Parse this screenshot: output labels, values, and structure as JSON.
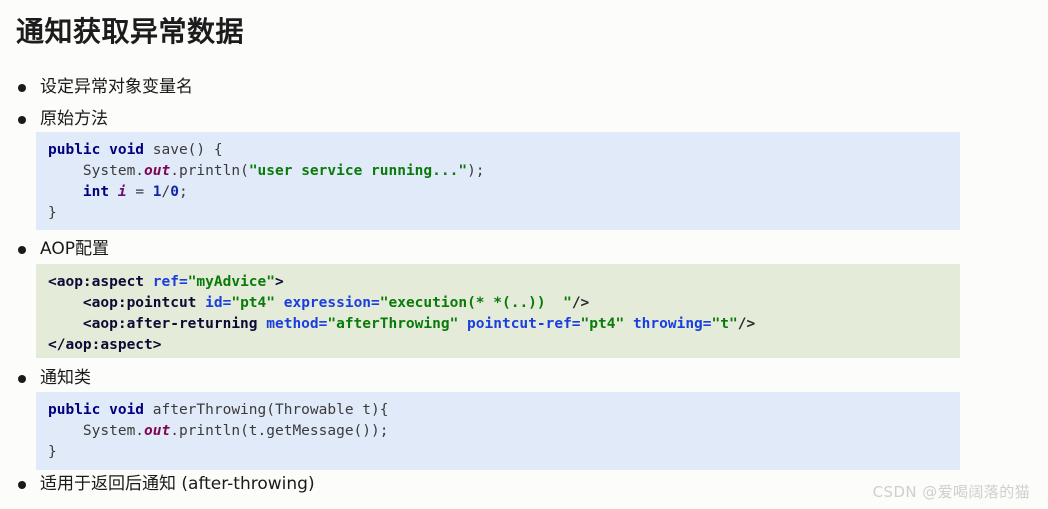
{
  "slide": {
    "title": "通知获取异常数据",
    "watermark": "CSDN @爱喝阔落的猫"
  },
  "bullets": [
    {
      "label": "设定异常对象变量名"
    },
    {
      "label": "原始方法"
    },
    {
      "label": "AOP配置"
    },
    {
      "label": "通知类"
    },
    {
      "label": "适用于返回后通知 (after-throwing)"
    }
  ],
  "code_blocks": [
    {
      "id": "java-save-method",
      "language": "java",
      "background": "#e1eaf8",
      "lines": [
        {
          "tokens": [
            {
              "t": "public void",
              "c": "kw"
            },
            {
              "t": " save() {",
              "c": "plain"
            }
          ]
        },
        {
          "tokens": [
            {
              "t": "    System.",
              "c": "plain"
            },
            {
              "t": "out",
              "c": "field"
            },
            {
              "t": ".println(",
              "c": "plain"
            },
            {
              "t": "\"user service running...\"",
              "c": "str"
            },
            {
              "t": ");",
              "c": "plain"
            }
          ]
        },
        {
          "tokens": [
            {
              "t": "    ",
              "c": "plain"
            },
            {
              "t": "int",
              "c": "kw"
            },
            {
              "t": " ",
              "c": "plain"
            },
            {
              "t": "i",
              "c": "var"
            },
            {
              "t": " = ",
              "c": "plain"
            },
            {
              "t": "1",
              "c": "num"
            },
            {
              "t": "/",
              "c": "plain"
            },
            {
              "t": "0",
              "c": "num"
            },
            {
              "t": ";",
              "c": "plain"
            }
          ]
        },
        {
          "tokens": [
            {
              "t": "}",
              "c": "plain"
            }
          ]
        }
      ]
    },
    {
      "id": "xml-aop-config",
      "language": "xml",
      "background": "#e4ebd8",
      "lines": [
        {
          "tokens": [
            {
              "t": "<aop:aspect",
              "c": "xtag"
            },
            {
              "t": " ",
              "c": "xpunc"
            },
            {
              "t": "ref=",
              "c": "xattr"
            },
            {
              "t": "\"myAdvice\"",
              "c": "xval"
            },
            {
              "t": ">",
              "c": "xtag"
            }
          ]
        },
        {
          "tokens": [
            {
              "t": "    <aop:pointcut",
              "c": "xtag"
            },
            {
              "t": " ",
              "c": "xpunc"
            },
            {
              "t": "id=",
              "c": "xattr"
            },
            {
              "t": "\"pt4\"",
              "c": "xval"
            },
            {
              "t": " ",
              "c": "xpunc"
            },
            {
              "t": "expression=",
              "c": "xattr"
            },
            {
              "t": "\"execution(* *(..))  \"",
              "c": "xval"
            },
            {
              "t": "/>",
              "c": "xpunc"
            }
          ]
        },
        {
          "tokens": [
            {
              "t": "    <aop:after-returning",
              "c": "xtag"
            },
            {
              "t": " ",
              "c": "xpunc"
            },
            {
              "t": "method=",
              "c": "xattr"
            },
            {
              "t": "\"afterThrowing\"",
              "c": "xval"
            },
            {
              "t": " ",
              "c": "xpunc"
            },
            {
              "t": "pointcut-ref=",
              "c": "xattr"
            },
            {
              "t": "\"pt4\"",
              "c": "xval"
            },
            {
              "t": " ",
              "c": "xpunc"
            },
            {
              "t": "throwing=",
              "c": "xattr"
            },
            {
              "t": "\"t\"",
              "c": "xval"
            },
            {
              "t": "/>",
              "c": "xpunc"
            }
          ]
        },
        {
          "tokens": [
            {
              "t": "</aop:aspect>",
              "c": "xtag"
            }
          ]
        }
      ]
    },
    {
      "id": "java-advice-class",
      "language": "java",
      "background": "#e1eaf8",
      "lines": [
        {
          "tokens": [
            {
              "t": "public void",
              "c": "kw"
            },
            {
              "t": " afterThrowing(Throwable t){",
              "c": "plain"
            }
          ]
        },
        {
          "tokens": [
            {
              "t": "    System.",
              "c": "plain"
            },
            {
              "t": "out",
              "c": "field"
            },
            {
              "t": ".println(t.getMessage());",
              "c": "plain"
            }
          ]
        },
        {
          "tokens": [
            {
              "t": "}",
              "c": "plain"
            }
          ]
        }
      ]
    }
  ],
  "colors": {
    "page_background": "#fcfdfa",
    "java_block_background": "#e1eaf8",
    "xml_block_background": "#e4ebd8",
    "keyword": "#00007f",
    "string": "#0a7a0a",
    "xml_attribute": "#1a3ee0",
    "watermark": "#cfcfcf"
  }
}
